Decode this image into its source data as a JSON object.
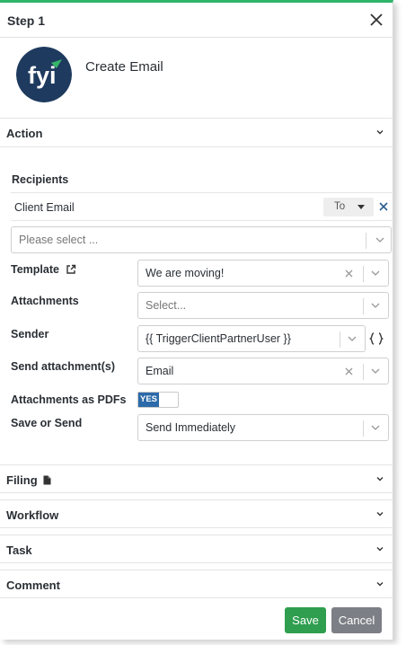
{
  "header": {
    "title": "Step 1",
    "close_icon": "close-icon"
  },
  "hero": {
    "logo_text": "fyi",
    "title": "Create Email",
    "colors": {
      "logo_bg": "#1e3a5f",
      "logo_accent": "#37b36a"
    }
  },
  "sections": {
    "action": "Action",
    "filing": "Filing",
    "workflow": "Workflow",
    "task": "Task",
    "comment": "Comment"
  },
  "recipients": {
    "label": "Recipients",
    "rows": [
      {
        "name": "Client Email",
        "type": "To"
      }
    ],
    "add_placeholder": "Please select ..."
  },
  "fields": {
    "template": {
      "label": "Template",
      "value": "We are moving!"
    },
    "attachments": {
      "label": "Attachments",
      "placeholder": "Select..."
    },
    "sender": {
      "label": "Sender",
      "value": "{{ TriggerClientPartnerUser }}"
    },
    "send_attachments": {
      "label": "Send attachment(s)",
      "value": "Email"
    },
    "attachments_as_pdfs": {
      "label": "Attachments as PDFs",
      "toggle": "YES",
      "on": true
    },
    "save_or_send": {
      "label": "Save or Send",
      "value": "Send Immediately"
    }
  },
  "footer": {
    "save": "Save",
    "cancel": "Cancel"
  },
  "colors": {
    "accent_top": "#2fb56a",
    "save": "#2f9e4f",
    "cancel": "#7c7f85",
    "toggle": "#2c6aa9"
  }
}
